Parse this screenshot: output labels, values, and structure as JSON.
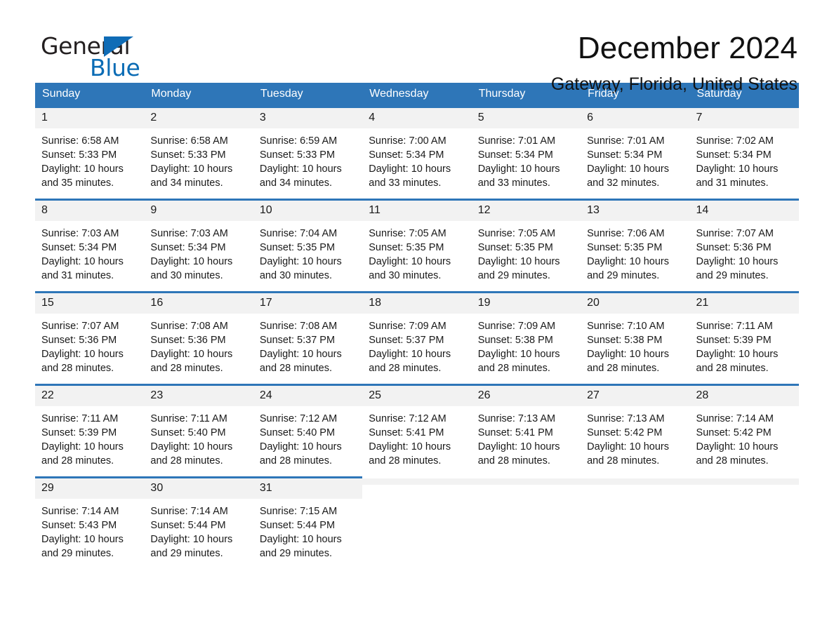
{
  "logo": {
    "word_one": "General",
    "word_two": "Blue",
    "flag_icon": "triangle-flag-icon",
    "accent_color": "#0f6cb6",
    "text_color": "#231f20"
  },
  "header": {
    "month_title": "December 2024",
    "location": "Gateway, Florida, United States"
  },
  "theme": {
    "header_bg": "#2e76b8",
    "daynum_bg": "#f2f2f2",
    "row_divider": "#2e76b8",
    "page_bg": "#ffffff",
    "text": "#1a1a1a"
  },
  "calendar": {
    "weekdays": [
      "Sunday",
      "Monday",
      "Tuesday",
      "Wednesday",
      "Thursday",
      "Friday",
      "Saturday"
    ],
    "weeks": [
      [
        {
          "day": "1",
          "sunrise": "Sunrise: 6:58 AM",
          "sunset": "Sunset: 5:33 PM",
          "daylight": "Daylight: 10 hours and 35 minutes."
        },
        {
          "day": "2",
          "sunrise": "Sunrise: 6:58 AM",
          "sunset": "Sunset: 5:33 PM",
          "daylight": "Daylight: 10 hours and 34 minutes."
        },
        {
          "day": "3",
          "sunrise": "Sunrise: 6:59 AM",
          "sunset": "Sunset: 5:33 PM",
          "daylight": "Daylight: 10 hours and 34 minutes."
        },
        {
          "day": "4",
          "sunrise": "Sunrise: 7:00 AM",
          "sunset": "Sunset: 5:34 PM",
          "daylight": "Daylight: 10 hours and 33 minutes."
        },
        {
          "day": "5",
          "sunrise": "Sunrise: 7:01 AM",
          "sunset": "Sunset: 5:34 PM",
          "daylight": "Daylight: 10 hours and 33 minutes."
        },
        {
          "day": "6",
          "sunrise": "Sunrise: 7:01 AM",
          "sunset": "Sunset: 5:34 PM",
          "daylight": "Daylight: 10 hours and 32 minutes."
        },
        {
          "day": "7",
          "sunrise": "Sunrise: 7:02 AM",
          "sunset": "Sunset: 5:34 PM",
          "daylight": "Daylight: 10 hours and 31 minutes."
        }
      ],
      [
        {
          "day": "8",
          "sunrise": "Sunrise: 7:03 AM",
          "sunset": "Sunset: 5:34 PM",
          "daylight": "Daylight: 10 hours and 31 minutes."
        },
        {
          "day": "9",
          "sunrise": "Sunrise: 7:03 AM",
          "sunset": "Sunset: 5:34 PM",
          "daylight": "Daylight: 10 hours and 30 minutes."
        },
        {
          "day": "10",
          "sunrise": "Sunrise: 7:04 AM",
          "sunset": "Sunset: 5:35 PM",
          "daylight": "Daylight: 10 hours and 30 minutes."
        },
        {
          "day": "11",
          "sunrise": "Sunrise: 7:05 AM",
          "sunset": "Sunset: 5:35 PM",
          "daylight": "Daylight: 10 hours and 30 minutes."
        },
        {
          "day": "12",
          "sunrise": "Sunrise: 7:05 AM",
          "sunset": "Sunset: 5:35 PM",
          "daylight": "Daylight: 10 hours and 29 minutes."
        },
        {
          "day": "13",
          "sunrise": "Sunrise: 7:06 AM",
          "sunset": "Sunset: 5:35 PM",
          "daylight": "Daylight: 10 hours and 29 minutes."
        },
        {
          "day": "14",
          "sunrise": "Sunrise: 7:07 AM",
          "sunset": "Sunset: 5:36 PM",
          "daylight": "Daylight: 10 hours and 29 minutes."
        }
      ],
      [
        {
          "day": "15",
          "sunrise": "Sunrise: 7:07 AM",
          "sunset": "Sunset: 5:36 PM",
          "daylight": "Daylight: 10 hours and 28 minutes."
        },
        {
          "day": "16",
          "sunrise": "Sunrise: 7:08 AM",
          "sunset": "Sunset: 5:36 PM",
          "daylight": "Daylight: 10 hours and 28 minutes."
        },
        {
          "day": "17",
          "sunrise": "Sunrise: 7:08 AM",
          "sunset": "Sunset: 5:37 PM",
          "daylight": "Daylight: 10 hours and 28 minutes."
        },
        {
          "day": "18",
          "sunrise": "Sunrise: 7:09 AM",
          "sunset": "Sunset: 5:37 PM",
          "daylight": "Daylight: 10 hours and 28 minutes."
        },
        {
          "day": "19",
          "sunrise": "Sunrise: 7:09 AM",
          "sunset": "Sunset: 5:38 PM",
          "daylight": "Daylight: 10 hours and 28 minutes."
        },
        {
          "day": "20",
          "sunrise": "Sunrise: 7:10 AM",
          "sunset": "Sunset: 5:38 PM",
          "daylight": "Daylight: 10 hours and 28 minutes."
        },
        {
          "day": "21",
          "sunrise": "Sunrise: 7:11 AM",
          "sunset": "Sunset: 5:39 PM",
          "daylight": "Daylight: 10 hours and 28 minutes."
        }
      ],
      [
        {
          "day": "22",
          "sunrise": "Sunrise: 7:11 AM",
          "sunset": "Sunset: 5:39 PM",
          "daylight": "Daylight: 10 hours and 28 minutes."
        },
        {
          "day": "23",
          "sunrise": "Sunrise: 7:11 AM",
          "sunset": "Sunset: 5:40 PM",
          "daylight": "Daylight: 10 hours and 28 minutes."
        },
        {
          "day": "24",
          "sunrise": "Sunrise: 7:12 AM",
          "sunset": "Sunset: 5:40 PM",
          "daylight": "Daylight: 10 hours and 28 minutes."
        },
        {
          "day": "25",
          "sunrise": "Sunrise: 7:12 AM",
          "sunset": "Sunset: 5:41 PM",
          "daylight": "Daylight: 10 hours and 28 minutes."
        },
        {
          "day": "26",
          "sunrise": "Sunrise: 7:13 AM",
          "sunset": "Sunset: 5:41 PM",
          "daylight": "Daylight: 10 hours and 28 minutes."
        },
        {
          "day": "27",
          "sunrise": "Sunrise: 7:13 AM",
          "sunset": "Sunset: 5:42 PM",
          "daylight": "Daylight: 10 hours and 28 minutes."
        },
        {
          "day": "28",
          "sunrise": "Sunrise: 7:14 AM",
          "sunset": "Sunset: 5:42 PM",
          "daylight": "Daylight: 10 hours and 28 minutes."
        }
      ],
      [
        {
          "day": "29",
          "sunrise": "Sunrise: 7:14 AM",
          "sunset": "Sunset: 5:43 PM",
          "daylight": "Daylight: 10 hours and 29 minutes."
        },
        {
          "day": "30",
          "sunrise": "Sunrise: 7:14 AM",
          "sunset": "Sunset: 5:44 PM",
          "daylight": "Daylight: 10 hours and 29 minutes."
        },
        {
          "day": "31",
          "sunrise": "Sunrise: 7:15 AM",
          "sunset": "Sunset: 5:44 PM",
          "daylight": "Daylight: 10 hours and 29 minutes."
        },
        {
          "day": "",
          "sunrise": "",
          "sunset": "",
          "daylight": ""
        },
        {
          "day": "",
          "sunrise": "",
          "sunset": "",
          "daylight": ""
        },
        {
          "day": "",
          "sunrise": "",
          "sunset": "",
          "daylight": ""
        },
        {
          "day": "",
          "sunrise": "",
          "sunset": "",
          "daylight": ""
        }
      ]
    ]
  }
}
